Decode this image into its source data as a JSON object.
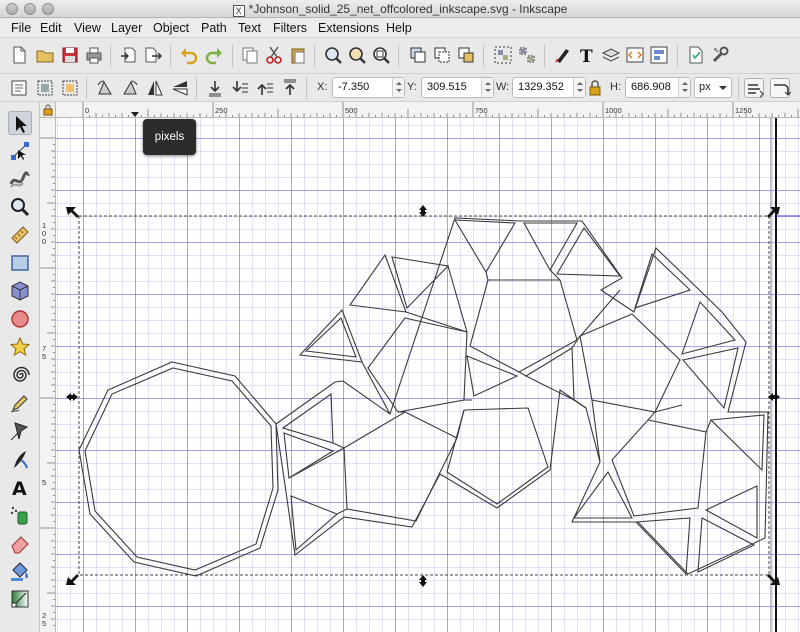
{
  "window": {
    "title": "*Johnson_solid_25_net_offcolored_inkscape.svg - Inkscape",
    "x_logo": "X"
  },
  "menubar": {
    "items": [
      "File",
      "Edit",
      "View",
      "Layer",
      "Object",
      "Path",
      "Text",
      "Filters",
      "Extensions",
      "Help"
    ]
  },
  "commands_bar": {
    "icons": [
      "new-document-icon",
      "open-document-icon",
      "save-icon",
      "print-icon",
      "import-icon",
      "export-icon",
      "undo-icon",
      "redo-icon",
      "copy-icon",
      "cut-icon",
      "paste-icon",
      "zoom-selection-icon",
      "zoom-drawing-icon",
      "zoom-page-icon",
      "duplicate-icon",
      "clone-icon",
      "unlink-clone-icon",
      "group-icon",
      "ungroup-icon",
      "fill-stroke-icon",
      "text-font-icon",
      "layers-icon",
      "xml-editor-icon",
      "align-distribute-icon",
      "document-properties-icon",
      "preferences-icon"
    ]
  },
  "select_toolbar": {
    "x_label": "X:",
    "x_value": "-7.350",
    "y_label": "Y:",
    "y_value": "309.515",
    "w_label": "W:",
    "w_value": "1329.352",
    "h_label": "H:",
    "h_value": "686.908",
    "unit": "px"
  },
  "toolbox": {
    "tools": [
      "selector-tool-icon",
      "node-tool-icon",
      "tweak-tool-icon",
      "zoom-tool-icon",
      "measure-tool-icon",
      "rectangle-tool-icon",
      "3d-box-tool-icon",
      "ellipse-tool-icon",
      "star-tool-icon",
      "spiral-tool-icon",
      "pencil-tool-icon",
      "pen-tool-icon",
      "calligraphy-tool-icon",
      "text-tool-icon",
      "spray-tool-icon",
      "eraser-tool-icon",
      "paint-bucket-tool-icon",
      "gradient-tool-icon"
    ],
    "active": "selector-tool-icon"
  },
  "rulers": {
    "horizontal": [
      "0",
      "250",
      "500",
      "750",
      "1000",
      "1250"
    ],
    "vertical_top": [
      "1",
      "0",
      "0"
    ],
    "vertical_mid": [
      "7",
      "5"
    ],
    "vertical_low": [
      "5"
    ],
    "vertical_bottom": [
      "2",
      "5"
    ]
  },
  "tooltip": {
    "text": "pixels"
  },
  "colors": {
    "grid_major": "#6e6ee6",
    "grid_minor": "#9696eb",
    "stroke": "#3a3a3a",
    "page_border": "#111111",
    "guide": "#3333dd"
  }
}
